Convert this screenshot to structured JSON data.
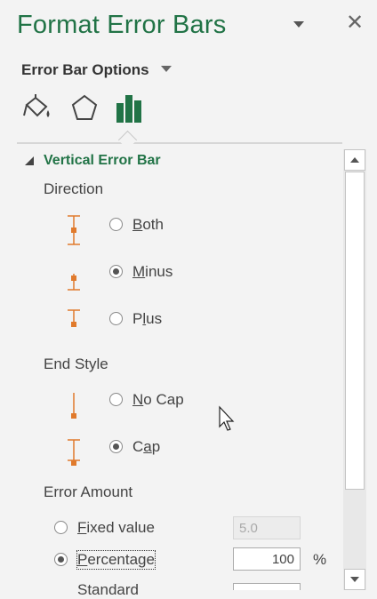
{
  "pane": {
    "title": "Format Error Bars",
    "options_label": "Error Bar Options"
  },
  "tabs": [
    "fill-line-icon",
    "effects-pentagon-icon",
    "bar-options-icon"
  ],
  "section": {
    "title": "Vertical Error Bar",
    "direction": {
      "label": "Direction",
      "options": [
        {
          "pre": "",
          "key": "B",
          "post": "oth",
          "selected": false
        },
        {
          "pre": "",
          "key": "M",
          "post": "inus",
          "selected": true
        },
        {
          "pre": "P",
          "key": "l",
          "post": "us",
          "selected": false
        }
      ]
    },
    "end_style": {
      "label": "End Style",
      "options": [
        {
          "pre": "",
          "key": "N",
          "post": "o Cap",
          "selected": false
        },
        {
          "pre": "C",
          "key": "a",
          "post": "p",
          "selected": true
        }
      ]
    },
    "error_amount": {
      "label": "Error Amount",
      "options": [
        {
          "pre": "",
          "key": "F",
          "post": "ixed value",
          "selected": false,
          "value": "5.0",
          "disabled": true
        },
        {
          "pre": "",
          "key": "P",
          "post": "ercentage",
          "selected": true,
          "value": "100",
          "unit": "%"
        },
        {
          "pre": "Standard",
          "key": "",
          "post": "",
          "selected": false
        }
      ]
    }
  },
  "colors": {
    "accent": "#217346",
    "glyph": "#e07a2c"
  }
}
